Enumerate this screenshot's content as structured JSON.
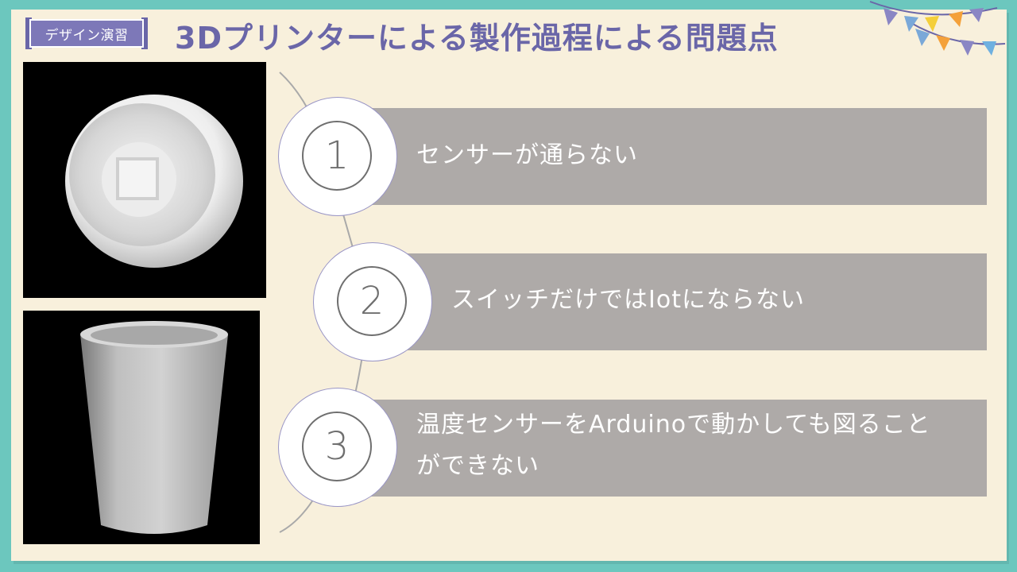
{
  "tag": {
    "label": "デザイン演習"
  },
  "title": "3Dプリンターによる製作過程による問題点",
  "images": [
    {
      "name": "sensor-lid-render"
    },
    {
      "name": "cup-render"
    }
  ],
  "issues": [
    {
      "number": "1",
      "text": "センサーが通らない"
    },
    {
      "number": "2",
      "text": "スイッチだけではIotにならない"
    },
    {
      "number": "3",
      "text_line1": "温度センサーをArduinoで動かしても図ること",
      "text_line2": "ができない"
    }
  ],
  "colors": {
    "background_outer": "#6cc7be",
    "slide": "#f8f0dc",
    "title": "#6a66a8",
    "tag": "#7d78b8",
    "item_bar": "#aeaaa8"
  }
}
